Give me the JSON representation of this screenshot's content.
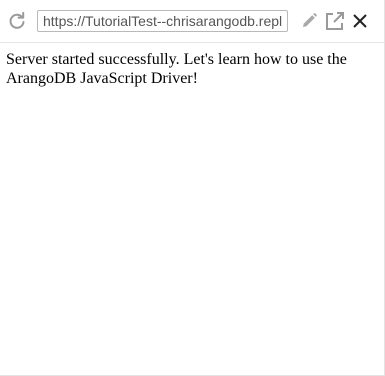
{
  "toolbar": {
    "url": "https://TutorialTest--chrisarangodb.repl.co",
    "icons": {
      "reload": "reload-icon",
      "edit": "pencil-icon",
      "open_external": "external-link-icon",
      "close": "close-icon"
    }
  },
  "page": {
    "message": "Server started successfully. Let's learn how to use the ArangoDB JavaScript Driver!"
  },
  "colors": {
    "icon": "#9a9a9a",
    "close_icon": "#222222",
    "url_text": "#555555",
    "url_border": "#b9b9b9",
    "toolbar_border": "#e6e6e6"
  }
}
